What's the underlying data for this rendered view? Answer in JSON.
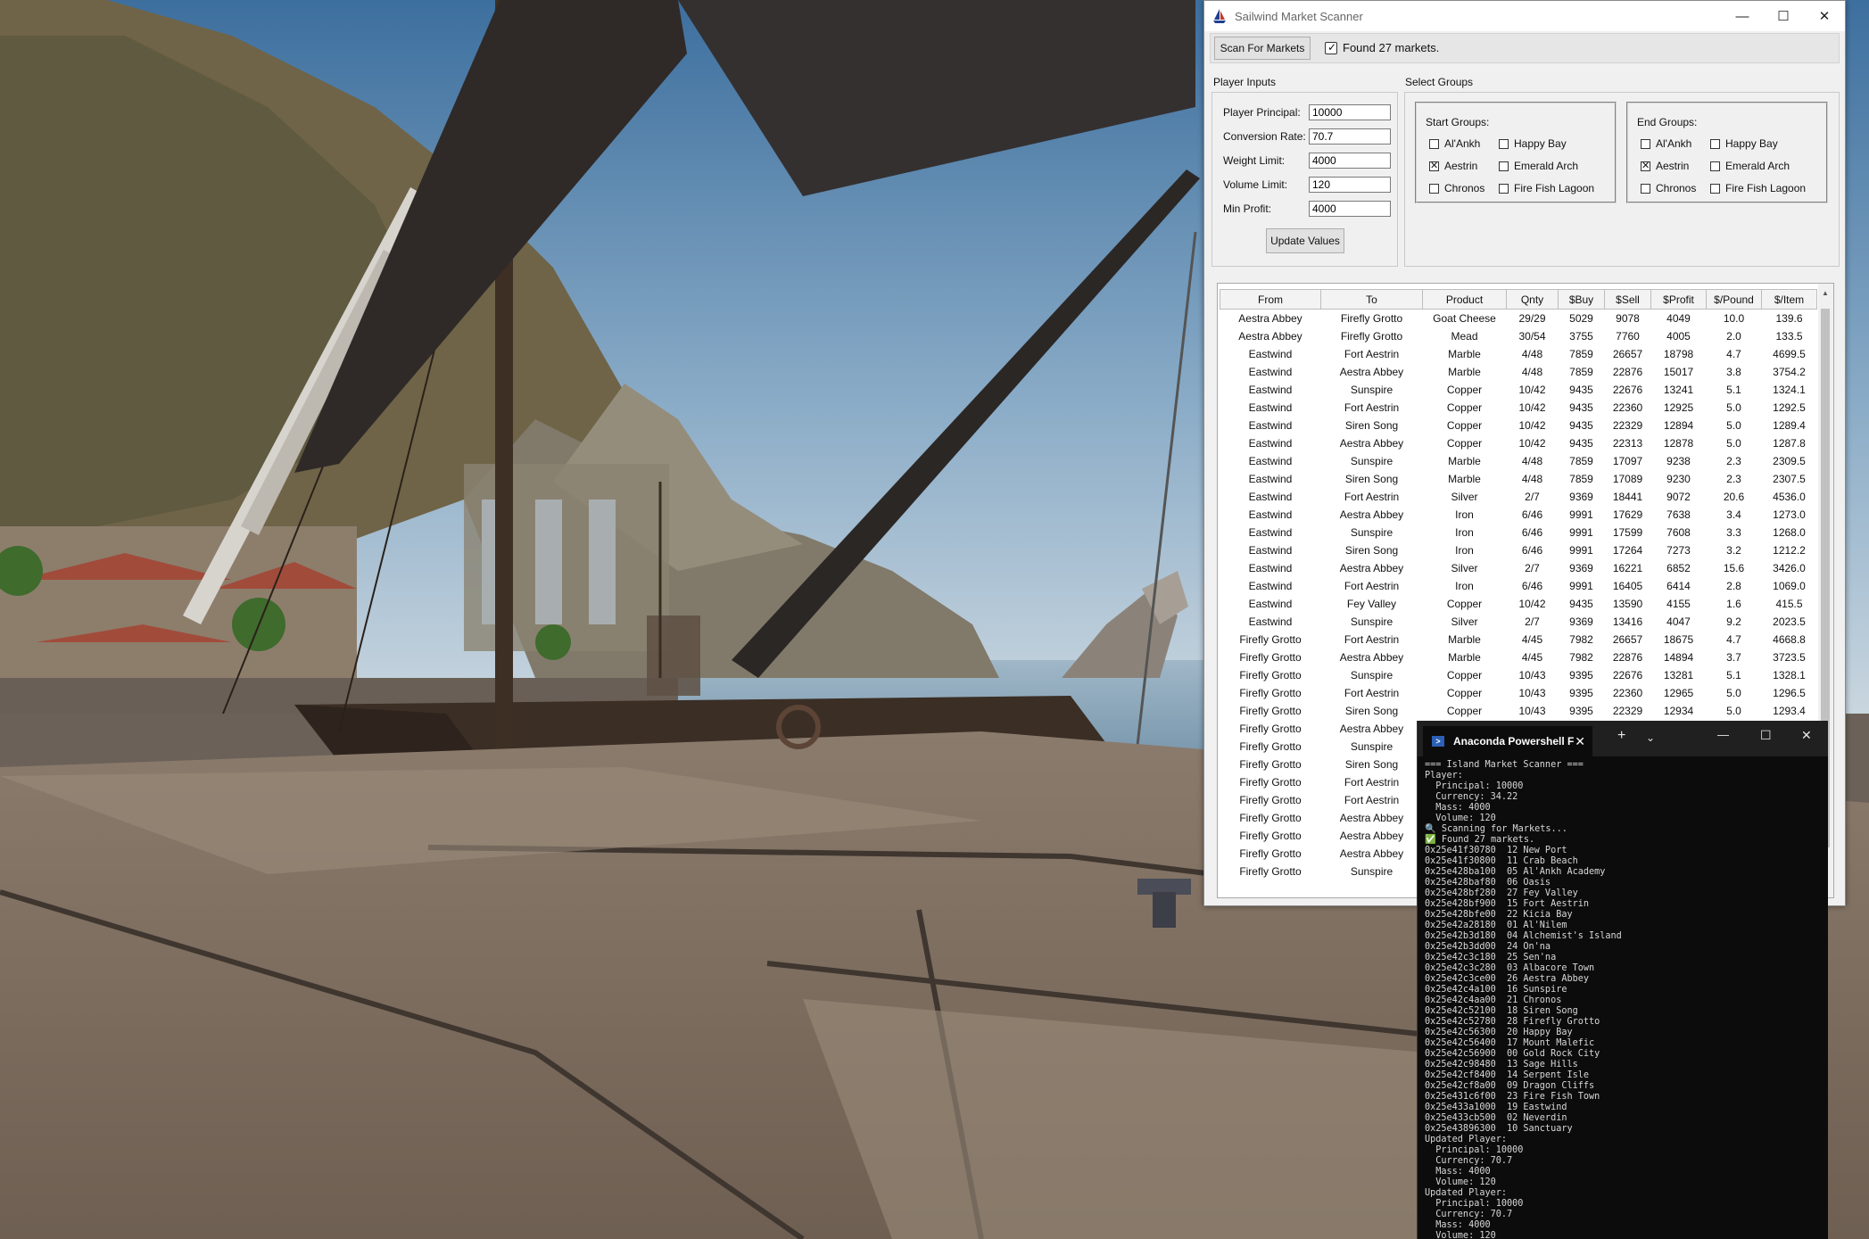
{
  "scanner": {
    "title": "Sailwind Market Scanner",
    "scan_button": "Scan For Markets",
    "status": "Found 27 markets.",
    "player_inputs": {
      "group_label": "Player Inputs",
      "fields": [
        {
          "label": "Player Principal:",
          "value": "10000"
        },
        {
          "label": "Conversion Rate:",
          "value": "70.7"
        },
        {
          "label": "Weight Limit:",
          "value": "4000"
        },
        {
          "label": "Volume Limit:",
          "value": "120"
        },
        {
          "label": "Min Profit:",
          "value": "4000"
        }
      ],
      "update_button": "Update Values"
    },
    "select_groups": {
      "group_label": "Select Groups",
      "start": {
        "label": "Start Groups:",
        "items": [
          {
            "name": "Al'Ankh",
            "checked": false
          },
          {
            "name": "Happy Bay",
            "checked": false
          },
          {
            "name": "Aestrin",
            "checked": true
          },
          {
            "name": "Emerald Arch",
            "checked": false
          },
          {
            "name": "Chronos",
            "checked": false
          },
          {
            "name": "Fire Fish Lagoon",
            "checked": false
          }
        ]
      },
      "end": {
        "label": "End Groups:",
        "items": [
          {
            "name": "Al'Ankh",
            "checked": false
          },
          {
            "name": "Happy Bay",
            "checked": false
          },
          {
            "name": "Aestrin",
            "checked": true
          },
          {
            "name": "Emerald Arch",
            "checked": false
          },
          {
            "name": "Chronos",
            "checked": false
          },
          {
            "name": "Fire Fish Lagoon",
            "checked": false
          }
        ]
      }
    },
    "table": {
      "columns": [
        "From",
        "To",
        "Product",
        "Qnty",
        "$Buy",
        "$Sell",
        "$Profit",
        "$/Pound",
        "$/Item"
      ],
      "rows": [
        [
          "Aestra Abbey",
          "Firefly Grotto",
          "Goat Cheese",
          "29/29",
          "5029",
          "9078",
          "4049",
          "10.0",
          "139.6"
        ],
        [
          "Aestra Abbey",
          "Firefly Grotto",
          "Mead",
          "30/54",
          "3755",
          "7760",
          "4005",
          "2.0",
          "133.5"
        ],
        [
          "Eastwind",
          "Fort Aestrin",
          "Marble",
          "4/48",
          "7859",
          "26657",
          "18798",
          "4.7",
          "4699.5"
        ],
        [
          "Eastwind",
          "Aestra Abbey",
          "Marble",
          "4/48",
          "7859",
          "22876",
          "15017",
          "3.8",
          "3754.2"
        ],
        [
          "Eastwind",
          "Sunspire",
          "Copper",
          "10/42",
          "9435",
          "22676",
          "13241",
          "5.1",
          "1324.1"
        ],
        [
          "Eastwind",
          "Fort Aestrin",
          "Copper",
          "10/42",
          "9435",
          "22360",
          "12925",
          "5.0",
          "1292.5"
        ],
        [
          "Eastwind",
          "Siren Song",
          "Copper",
          "10/42",
          "9435",
          "22329",
          "12894",
          "5.0",
          "1289.4"
        ],
        [
          "Eastwind",
          "Aestra Abbey",
          "Copper",
          "10/42",
          "9435",
          "22313",
          "12878",
          "5.0",
          "1287.8"
        ],
        [
          "Eastwind",
          "Sunspire",
          "Marble",
          "4/48",
          "7859",
          "17097",
          "9238",
          "2.3",
          "2309.5"
        ],
        [
          "Eastwind",
          "Siren Song",
          "Marble",
          "4/48",
          "7859",
          "17089",
          "9230",
          "2.3",
          "2307.5"
        ],
        [
          "Eastwind",
          "Fort Aestrin",
          "Silver",
          "2/7",
          "9369",
          "18441",
          "9072",
          "20.6",
          "4536.0"
        ],
        [
          "Eastwind",
          "Aestra Abbey",
          "Iron",
          "6/46",
          "9991",
          "17629",
          "7638",
          "3.4",
          "1273.0"
        ],
        [
          "Eastwind",
          "Sunspire",
          "Iron",
          "6/46",
          "9991",
          "17599",
          "7608",
          "3.3",
          "1268.0"
        ],
        [
          "Eastwind",
          "Siren Song",
          "Iron",
          "6/46",
          "9991",
          "17264",
          "7273",
          "3.2",
          "1212.2"
        ],
        [
          "Eastwind",
          "Aestra Abbey",
          "Silver",
          "2/7",
          "9369",
          "16221",
          "6852",
          "15.6",
          "3426.0"
        ],
        [
          "Eastwind",
          "Fort Aestrin",
          "Iron",
          "6/46",
          "9991",
          "16405",
          "6414",
          "2.8",
          "1069.0"
        ],
        [
          "Eastwind",
          "Fey Valley",
          "Copper",
          "10/42",
          "9435",
          "13590",
          "4155",
          "1.6",
          "415.5"
        ],
        [
          "Eastwind",
          "Sunspire",
          "Silver",
          "2/7",
          "9369",
          "13416",
          "4047",
          "9.2",
          "2023.5"
        ],
        [
          "Firefly Grotto",
          "Fort Aestrin",
          "Marble",
          "4/45",
          "7982",
          "26657",
          "18675",
          "4.7",
          "4668.8"
        ],
        [
          "Firefly Grotto",
          "Aestra Abbey",
          "Marble",
          "4/45",
          "7982",
          "22876",
          "14894",
          "3.7",
          "3723.5"
        ],
        [
          "Firefly Grotto",
          "Sunspire",
          "Copper",
          "10/43",
          "9395",
          "22676",
          "13281",
          "5.1",
          "1328.1"
        ],
        [
          "Firefly Grotto",
          "Fort Aestrin",
          "Copper",
          "10/43",
          "9395",
          "22360",
          "12965",
          "5.0",
          "1296.5"
        ],
        [
          "Firefly Grotto",
          "Siren Song",
          "Copper",
          "10/43",
          "9395",
          "22329",
          "12934",
          "5.0",
          "1293.4"
        ],
        [
          "Firefly Grotto",
          "Aestra Abbey",
          "",
          "",
          "",
          "",
          "",
          "",
          ""
        ],
        [
          "Firefly Grotto",
          "Sunspire",
          "",
          "",
          "",
          "",
          "",
          "",
          ""
        ],
        [
          "Firefly Grotto",
          "Siren Song",
          "",
          "",
          "",
          "",
          "",
          "",
          ""
        ],
        [
          "Firefly Grotto",
          "Fort Aestrin",
          "",
          "",
          "",
          "",
          "",
          "",
          ""
        ],
        [
          "Firefly Grotto",
          "Fort Aestrin",
          "",
          "",
          "",
          "",
          "",
          "",
          ""
        ],
        [
          "Firefly Grotto",
          "Aestra Abbey",
          "",
          "",
          "",
          "",
          "",
          "",
          ""
        ],
        [
          "Firefly Grotto",
          "Aestra Abbey",
          "",
          "",
          "",
          "",
          "",
          "",
          ""
        ],
        [
          "Firefly Grotto",
          "Aestra Abbey",
          "",
          "",
          "",
          "",
          "",
          "",
          ""
        ],
        [
          "Firefly Grotto",
          "Sunspire",
          "",
          "",
          "",
          "",
          "",
          "",
          ""
        ]
      ]
    }
  },
  "terminal": {
    "tab_title": "Anaconda Powershell F",
    "lines": [
      "=== Island Market Scanner ===",
      "Player:",
      "  Principal: 10000",
      "  Currency: 34.22",
      "  Mass: 4000",
      "  Volume: 120",
      "🔍 Scanning for Markets...",
      "✅ Found 27 markets.",
      "0x25e41f30780  12 New Port",
      "0x25e41f30800  11 Crab Beach",
      "0x25e428ba100  05 Al'Ankh Academy",
      "0x25e428baf80  06 Oasis",
      "0x25e428bf280  27 Fey Valley",
      "0x25e428bf900  15 Fort Aestrin",
      "0x25e428bfe00  22 Kicia Bay",
      "0x25e42a28180  01 Al'Nilem",
      "0x25e42b3d180  04 Alchemist's Island",
      "0x25e42b3dd00  24 On'na",
      "0x25e42c3c180  25 Sen'na",
      "0x25e42c3c280  03 Albacore Town",
      "0x25e42c3ce00  26 Aestra Abbey",
      "0x25e42c4a100  16 Sunspire",
      "0x25e42c4aa00  21 Chronos",
      "0x25e42c52100  18 Siren Song",
      "0x25e42c52780  28 Firefly Grotto",
      "0x25e42c56300  20 Happy Bay",
      "0x25e42c56400  17 Mount Malefic",
      "0x25e42c56900  00 Gold Rock City",
      "0x25e42c98480  13 Sage Hills",
      "0x25e42cf8400  14 Serpent Isle",
      "0x25e42cf8a00  09 Dragon Cliffs",
      "0x25e431c6f00  23 Fire Fish Town",
      "0x25e433a1000  19 Eastwind",
      "0x25e433cb500  02 Neverdin",
      "0x25e43896300  10 Sanctuary",
      "Updated Player:",
      "  Principal: 10000",
      "  Currency: 70.7",
      "  Mass: 4000",
      "  Volume: 120",
      "Updated Player:",
      "  Principal: 10000",
      "  Currency: 70.7",
      "  Mass: 4000",
      "  Volume: 120"
    ]
  }
}
